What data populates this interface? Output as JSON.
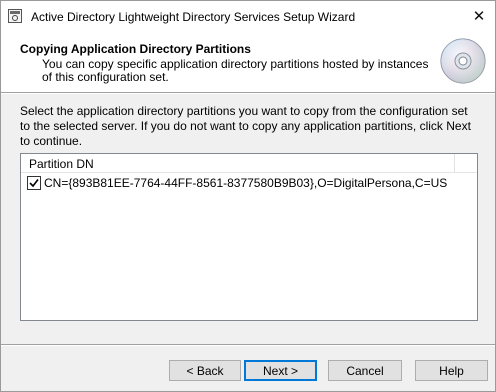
{
  "window": {
    "title": "Active Directory Lightweight Directory Services Setup Wizard",
    "close_glyph": "✕"
  },
  "header": {
    "title": "Copying Application Directory Partitions",
    "description": "You can copy specific application directory partitions hosted by instances of this configuration set.",
    "icon": "cd-disc-icon"
  },
  "instructions": "Select the application directory partitions you want to copy from the configuration set to the selected server. If you do not want to copy any application partitions, click Next to continue.",
  "partition_list": {
    "column_header": "Partition DN",
    "rows": [
      {
        "label": "CN={893B81EE-7764-44FF-8561-8377580B9B03},O=DigitalPersona,C=US",
        "checked": true
      }
    ]
  },
  "buttons": {
    "back": "< Back",
    "next": "Next >",
    "cancel": "Cancel",
    "help": "Help"
  },
  "colors": {
    "accent": "#0078d7",
    "dialog_bg": "#f0f0f0"
  }
}
